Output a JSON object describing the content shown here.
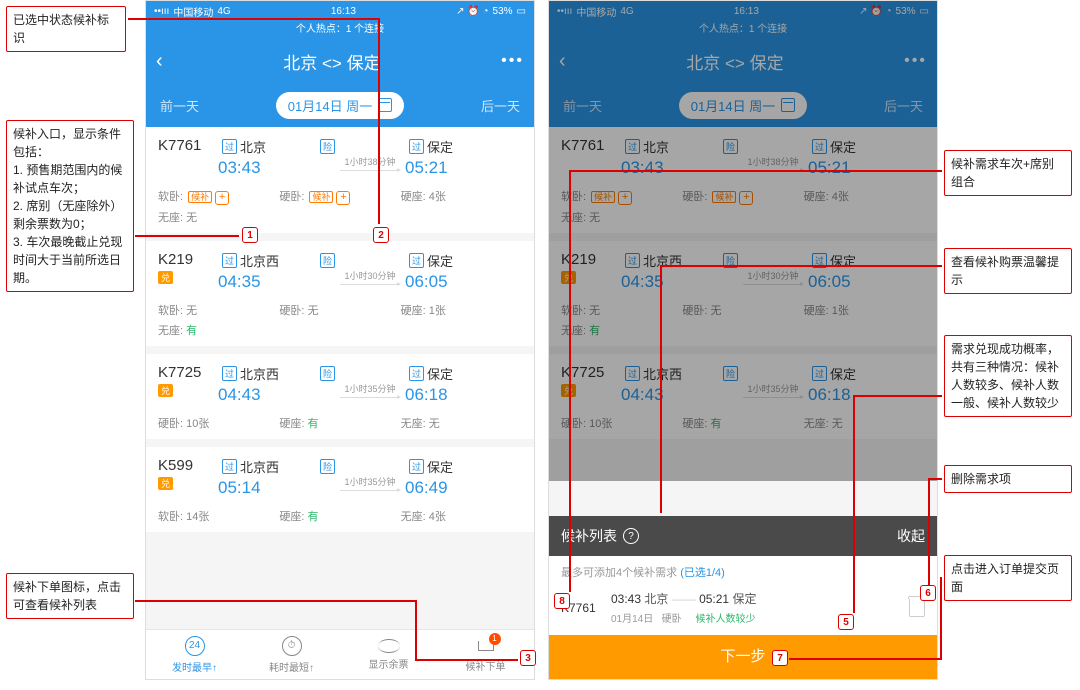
{
  "status": {
    "carrier": "中国移动",
    "net": "4G",
    "time": "16:13",
    "battery": "53%"
  },
  "hotspot": "个人热点：1 个连接",
  "nav": {
    "title": "北京 <> 保定"
  },
  "datebar": {
    "prev": "前一天",
    "date": "01月14日 周一",
    "next": "后一天"
  },
  "trains": [
    {
      "no": "K7761",
      "from": "北京",
      "fTime": "03:43",
      "dur": "1小时38分钟",
      "to": "保定",
      "tTime": "05:21",
      "seats": [
        {
          "name": "软卧:",
          "val": "候补",
          "cand": true,
          "plus": true,
          "marker": "1"
        },
        {
          "name": "硬卧:",
          "val": "候补",
          "cand": true,
          "plus": true,
          "marker": "2"
        },
        {
          "name": "硬座:",
          "val": "4张"
        }
      ],
      "extra": [
        {
          "name": "无座:",
          "val": "无"
        }
      ],
      "badge": false
    },
    {
      "no": "K219",
      "from": "北京西",
      "fTime": "04:35",
      "dur": "1小时30分钟",
      "to": "保定",
      "tTime": "06:05",
      "seats": [
        {
          "name": "软卧:",
          "val": "无"
        },
        {
          "name": "硬卧:",
          "val": "无"
        },
        {
          "name": "硬座:",
          "val": "1张"
        }
      ],
      "extra": [
        {
          "name": "无座:",
          "val": "有",
          "green": true
        }
      ],
      "badge": true
    },
    {
      "no": "K7725",
      "from": "北京西",
      "fTime": "04:43",
      "dur": "1小时35分钟",
      "to": "保定",
      "tTime": "06:18",
      "seats": [
        {
          "name": "硬卧:",
          "val": "10张"
        },
        {
          "name": "硬座:",
          "val": "有",
          "green": true
        },
        {
          "name": "无座:",
          "val": "无"
        }
      ],
      "extra": [],
      "badge": true
    },
    {
      "no": "K599",
      "from": "北京西",
      "fTime": "05:14",
      "dur": "1小时35分钟",
      "to": "保定",
      "tTime": "06:49",
      "seats": [
        {
          "name": "软卧:",
          "val": "14张"
        },
        {
          "name": "硬座:",
          "val": "有",
          "green": true
        },
        {
          "name": "无座:",
          "val": "4张"
        }
      ],
      "extra": [],
      "badge": true
    }
  ],
  "tabs": [
    {
      "label": "发时最早",
      "up": "↑"
    },
    {
      "label": "耗时最短",
      "up": "↑"
    },
    {
      "label": "显示余票",
      "up": ""
    },
    {
      "label": "候补下单",
      "up": "",
      "count": "1"
    }
  ],
  "sheet": {
    "title": "候补列表",
    "collapse": "收起",
    "sub_a": "最多可添加4个候补需求",
    "sub_b": "(已选1/4)",
    "req": {
      "no": "K7761",
      "dep_t": "03:43",
      "dep": "北京",
      "arr_t": "05:21",
      "arr": "保定",
      "line2_a": "01月14日",
      "line2_b": "硬卧",
      "rate": "候补人数较少"
    },
    "next": "下一步"
  },
  "markers": {
    "m1": "1",
    "m2": "2",
    "m3": "3",
    "m5": "5",
    "m6": "6",
    "m7": "7",
    "m8": "8"
  },
  "ann": {
    "a1": "已选中状态候补标识",
    "a2": "候补入口，显示条件包括：\n1. 预售期范围内的候补试点车次；\n2. 席别（无座除外）剩余票数为0；\n3. 车次最晚截止兑现时间大于当前所选日期。",
    "a3": "候补下单图标，点击可查看候补列表",
    "b1": "候补需求车次+席别组合",
    "b2": "查看候补购票温馨提示",
    "b3": "需求兑现成功概率，共有三种情况：候补人数较多、候补人数一般、候补人数较少",
    "b4": "删除需求项",
    "b5": "点击进入订单提交页面"
  },
  "glyph": {
    "pass": "过",
    "start": "始",
    "badge": "兑"
  }
}
